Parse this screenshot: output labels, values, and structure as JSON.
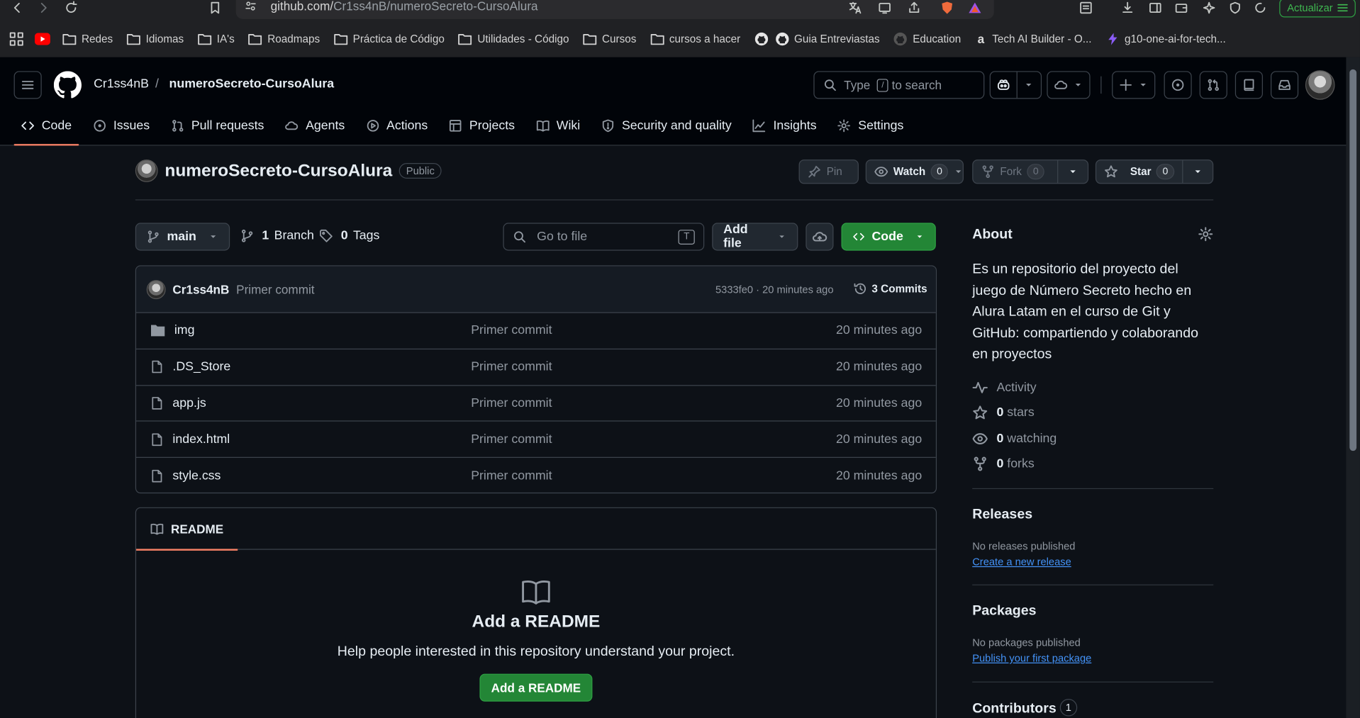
{
  "browser": {
    "url_host": "github.com/",
    "url_path": "Cr1ss4nB/numeroSecreto-CursoAlura",
    "update_label": "Actualizar",
    "bookmarks": [
      "Redes",
      "Idiomas",
      "IA's",
      "Roadmaps",
      "Práctica de Código",
      "Utilidades - Código",
      "Cursos",
      "cursos a hacer",
      "Guia Entreviastas",
      "Education",
      "Tech AI Builder - O...",
      "g10-one-ai-for-tech..."
    ]
  },
  "header": {
    "owner": "Cr1ss4nB",
    "separator": "/",
    "repo": "numeroSecreto-CursoAlura",
    "search_prefix": "Type",
    "search_key": "/",
    "search_suffix": "to search"
  },
  "tabs": [
    "Code",
    "Issues",
    "Pull requests",
    "Agents",
    "Actions",
    "Projects",
    "Wiki",
    "Security and quality",
    "Insights",
    "Settings"
  ],
  "repo": {
    "name": "numeroSecreto-CursoAlura",
    "visibility": "Public",
    "pin_label": "Pin",
    "watch_label": "Watch",
    "watch_count": "0",
    "fork_label": "Fork",
    "fork_count": "0",
    "star_label": "Star",
    "star_count": "0"
  },
  "toolbar": {
    "branch": "main",
    "branches_count": "1",
    "branches_label": "Branch",
    "tags_count": "0",
    "tags_label": "Tags",
    "goto_placeholder": "Go to file",
    "goto_key": "T",
    "add_file_label": "Add file",
    "code_label": "Code"
  },
  "latest_commit": {
    "author": "Cr1ss4nB",
    "message": "Primer commit",
    "meta": "5333fe0 · 20 minutes ago",
    "commits_label": "3 Commits"
  },
  "files": [
    {
      "name": "img",
      "type": "folder",
      "message": "Primer commit",
      "age": "20 minutes ago"
    },
    {
      "name": ".DS_Store",
      "type": "file",
      "message": "Primer commit",
      "age": "20 minutes ago"
    },
    {
      "name": "app.js",
      "type": "file",
      "message": "Primer commit",
      "age": "20 minutes ago"
    },
    {
      "name": "index.html",
      "type": "file",
      "message": "Primer commit",
      "age": "20 minutes ago"
    },
    {
      "name": "style.css",
      "type": "file",
      "message": "Primer commit",
      "age": "20 minutes ago"
    }
  ],
  "readme": {
    "tab_label": "README",
    "title": "Add a README",
    "description": "Help people interested in this repository understand your project.",
    "button": "Add a README"
  },
  "about": {
    "heading": "About",
    "description": "Es un repositorio del proyecto del juego de Número Secreto hecho en Alura Latam en el curso de Git y GitHub: compartiendo y colaborando en proyectos",
    "activity": "Activity",
    "stars_count": "0",
    "stars_label": "stars",
    "watching_count": "0",
    "watching_label": "watching",
    "forks_count": "0",
    "forks_label": "forks"
  },
  "releases": {
    "heading": "Releases",
    "empty": "No releases published",
    "link": "Create a new release"
  },
  "packages": {
    "heading": "Packages",
    "empty": "No packages published",
    "link": "Publish your first package"
  },
  "contributors": {
    "heading": "Contributors",
    "count": "1"
  }
}
